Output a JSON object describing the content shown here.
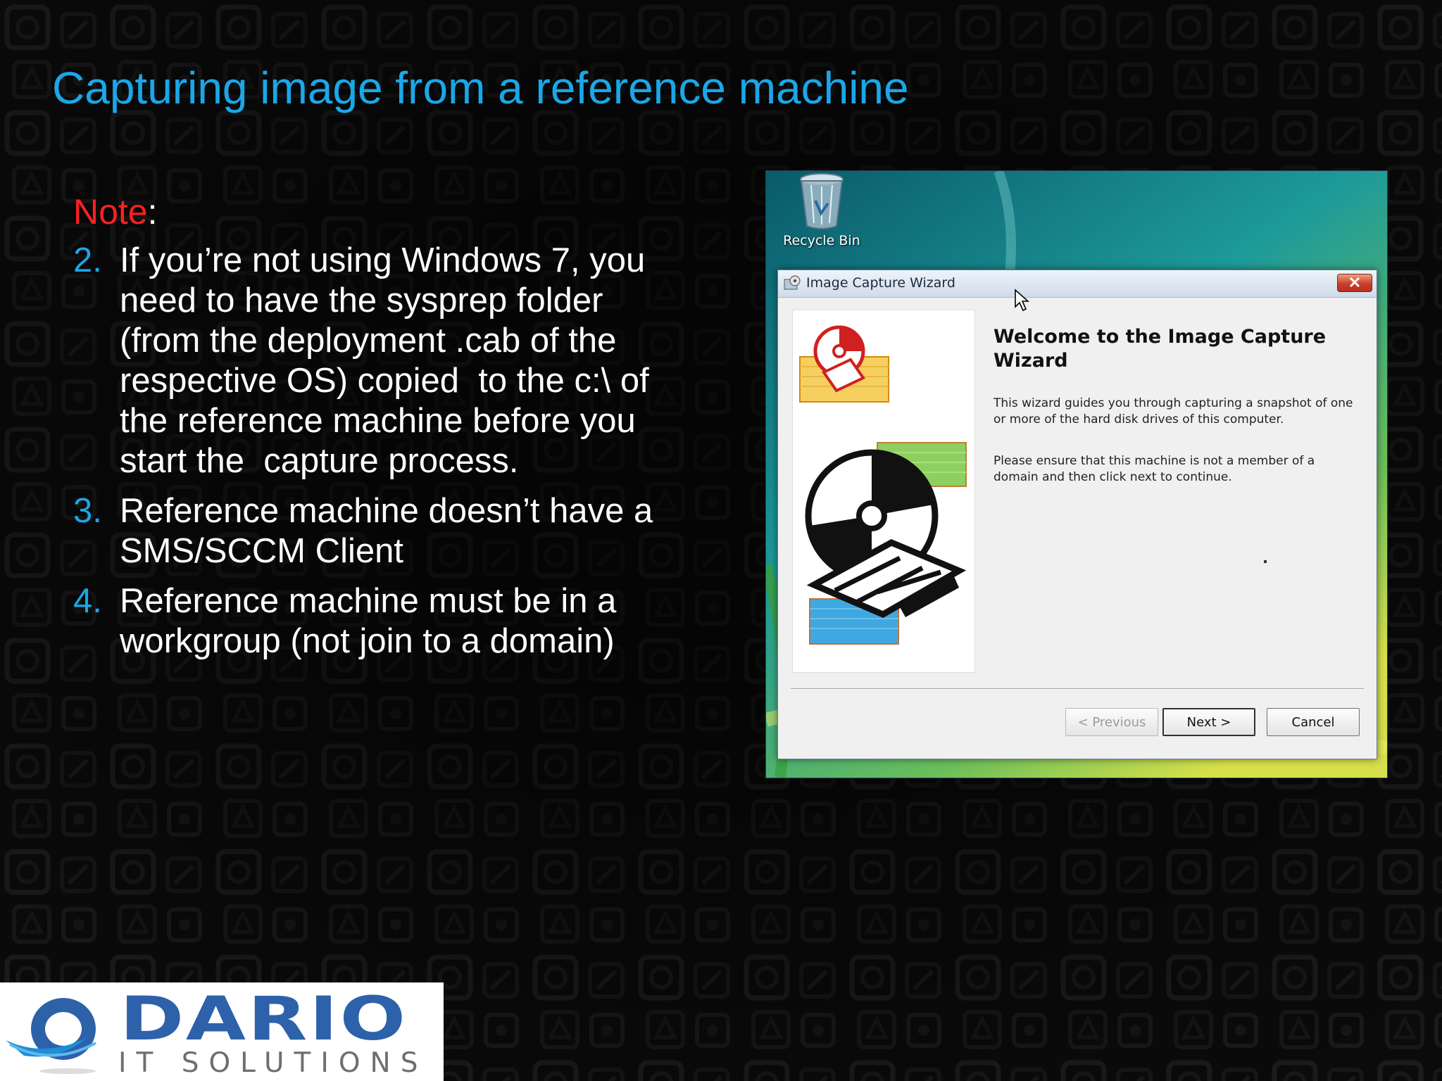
{
  "slide": {
    "title": "Capturing image from a reference machine",
    "note_word": "Note",
    "note_colon": ":",
    "items": [
      {
        "num": "2.",
        "text": "If you’re not using Windows 7, you need to have the sysprep folder (from the deployment .cab of the respective OS) copied  to the c:\\ of the reference machine before you start the  capture process."
      },
      {
        "num": "3.",
        "text": "Reference machine doesn’t have a SMS/SCCM Client"
      },
      {
        "num": "4.",
        "text": "Reference machine must be in a workgroup (not join to a domain)"
      }
    ]
  },
  "desktop": {
    "recycle_bin_label": "Recycle Bin"
  },
  "wizard": {
    "title": "Image Capture Wizard",
    "heading": "Welcome to the Image Capture Wizard",
    "paragraph_1": "This wizard guides you through capturing a snapshot of one or more of the hard disk drives of this computer.",
    "paragraph_2": "Please ensure that this machine is not a member of a domain and then click next to continue.",
    "buttons": {
      "previous": "< Previous",
      "next": "Next >",
      "cancel": "Cancel"
    },
    "previous_enabled": false
  },
  "logo": {
    "main": "DARIO",
    "sub": "IT SOLUTIONS"
  },
  "colors": {
    "title": "#1aa7e8",
    "note": "#ff2020",
    "bullet_number": "#1aa7e8",
    "logo_blue": "#2d62aa"
  },
  "icons": [
    "recycle-bin-icon",
    "wizard-app-icon",
    "close-icon",
    "mouse-cursor-icon",
    "cd-disk-icon",
    "logo-swirl-icon"
  ]
}
